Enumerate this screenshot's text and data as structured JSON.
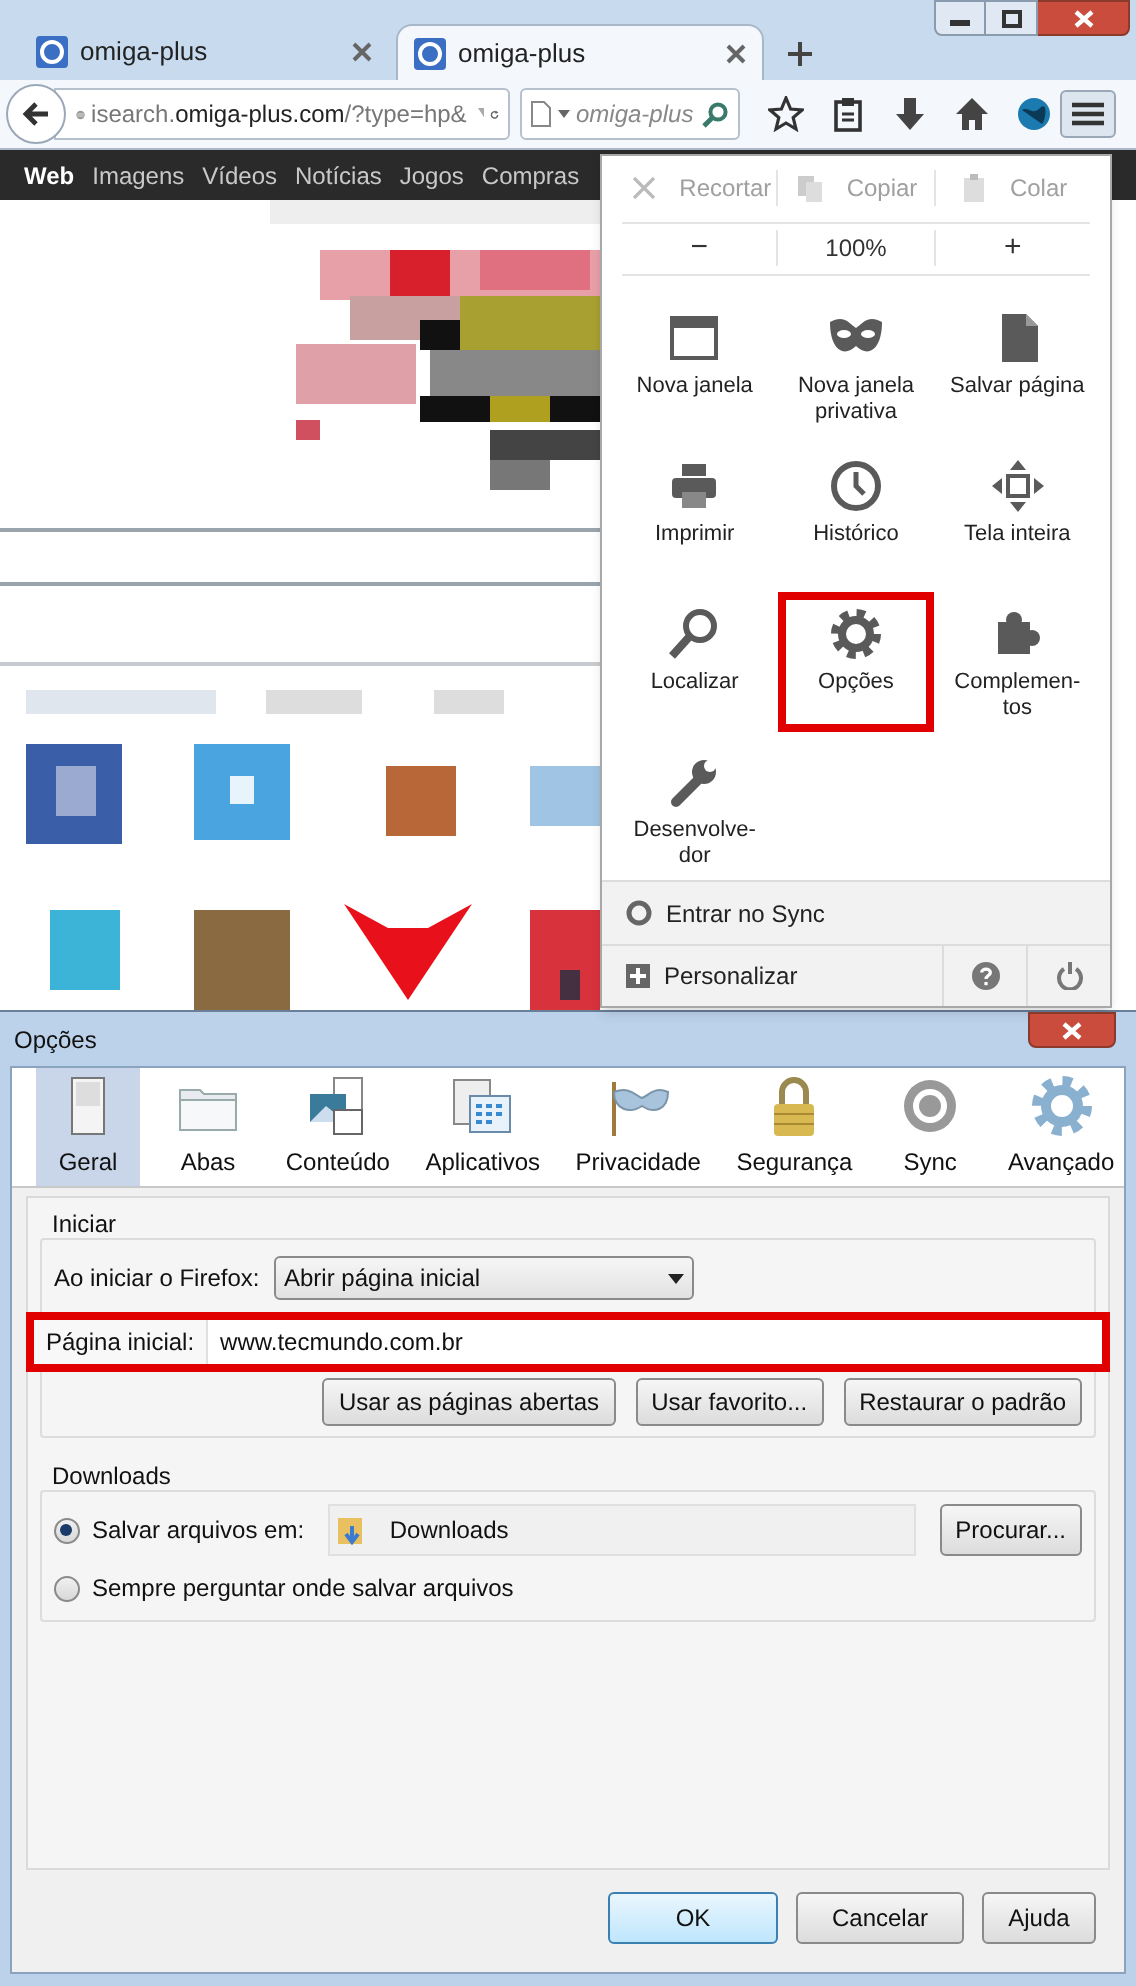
{
  "browser": {
    "tabs": [
      {
        "title": "omiga-plus",
        "selected": false
      },
      {
        "title": "omiga-plus",
        "selected": true
      }
    ],
    "url": "isearch.**omiga-plus.com**/?type=hp&",
    "search": {
      "placeholder": "omiga-plus"
    },
    "search_nav": [
      {
        "label": "Web",
        "selected": true
      },
      {
        "label": "Imagens",
        "selected": false
      },
      {
        "label": "Vídeos",
        "selected": false
      },
      {
        "label": "Notícias",
        "selected": false
      },
      {
        "label": "Jogos",
        "selected": false
      },
      {
        "label": "Compras",
        "selected": false
      }
    ],
    "menu": {
      "edit": [
        {
          "label": "Recortar",
          "disabled": true
        },
        {
          "label": "Copiar",
          "disabled": true
        },
        {
          "label": "Colar",
          "disabled": true
        }
      ],
      "zoom": {
        "out": "−",
        "level": "100%",
        "in": "+"
      },
      "items": [
        {
          "label": "Nova janela",
          "highlighted": false
        },
        {
          "label": "Nova janela privativa",
          "highlighted": false
        },
        {
          "label": "Salvar página",
          "highlighted": false
        },
        {
          "label": "Imprimir",
          "highlighted": false
        },
        {
          "label": "Histórico",
          "highlighted": false
        },
        {
          "label": "Tela inteira",
          "highlighted": false
        },
        {
          "label": "Localizar",
          "highlighted": false
        },
        {
          "label": "Opções",
          "highlighted": true
        },
        {
          "label": "Complemen-\ntos",
          "highlighted": false
        },
        {
          "label": "Desenvolve-\ndor",
          "highlighted": false
        }
      ],
      "sync": "Entrar no Sync",
      "customize": "Personalizar"
    }
  },
  "dialog": {
    "title": "Opções",
    "tabs": [
      {
        "label": "Geral",
        "selected": true
      },
      {
        "label": "Abas",
        "selected": false
      },
      {
        "label": "Conteúdo",
        "selected": false
      },
      {
        "label": "Aplicativos",
        "selected": false
      },
      {
        "label": "Privacidade",
        "selected": false
      },
      {
        "label": "Segurança",
        "selected": false
      },
      {
        "label": "Sync",
        "selected": false
      },
      {
        "label": "Avançado",
        "selected": false
      }
    ],
    "startup": {
      "legend": "Iniciar",
      "when_label": "Ao iniciar o Firefox:",
      "when_value": "Abrir página inicial",
      "home_label": "Página inicial:",
      "home_value": "www.tecmundo.com.br",
      "highlighted": true,
      "buttons": [
        "Usar as páginas abertas",
        "Usar favorito...",
        "Restaurar o padrão"
      ]
    },
    "downloads": {
      "legend": "Downloads",
      "options": [
        {
          "kind": "folder",
          "label": "Salvar arquivos em:",
          "selected": true,
          "folder": "Downloads",
          "button": "Procurar..."
        },
        {
          "kind": "plain",
          "label": "Sempre perguntar onde salvar arquivos",
          "selected": false
        }
      ]
    },
    "buttons": [
      {
        "label": "OK",
        "default": true
      },
      {
        "label": "Cancelar",
        "default": false
      },
      {
        "label": "Ajuda",
        "default": false
      }
    ]
  }
}
